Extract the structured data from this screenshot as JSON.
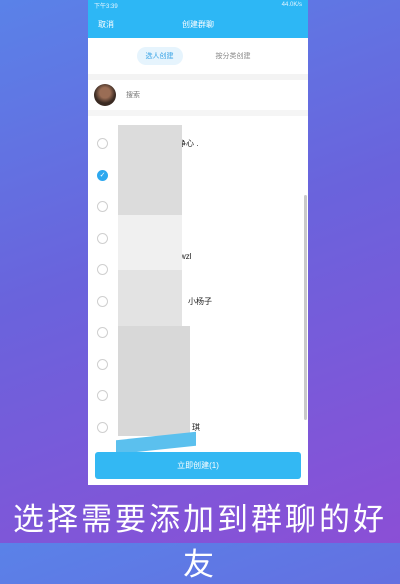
{
  "status": {
    "time": "下午3:39",
    "right": "44.0K/s"
  },
  "nav": {
    "title": "创建群聊",
    "cancel_label": "取消"
  },
  "tabs": [
    "选人创建",
    "按分类创建"
  ],
  "search": {
    "placeholder": "搜索"
  },
  "contacts": [
    {
      "name": "",
      "checked": false
    },
    {
      "name": "净心 .",
      "checked": false
    },
    {
      "name": "",
      "checked": true
    },
    {
      "name": "",
      "checked": false
    },
    {
      "name": "",
      "checked": false
    },
    {
      "name": "wzl",
      "checked": false
    },
    {
      "name": "小杨子",
      "checked": false
    },
    {
      "name": "",
      "checked": false
    },
    {
      "name": "",
      "checked": false
    },
    {
      "name": "",
      "checked": false
    },
    {
      "name": "琪",
      "checked": false
    }
  ],
  "action": {
    "label": "立即创建(1)"
  },
  "caption": "选择需要添加到群聊的好友"
}
